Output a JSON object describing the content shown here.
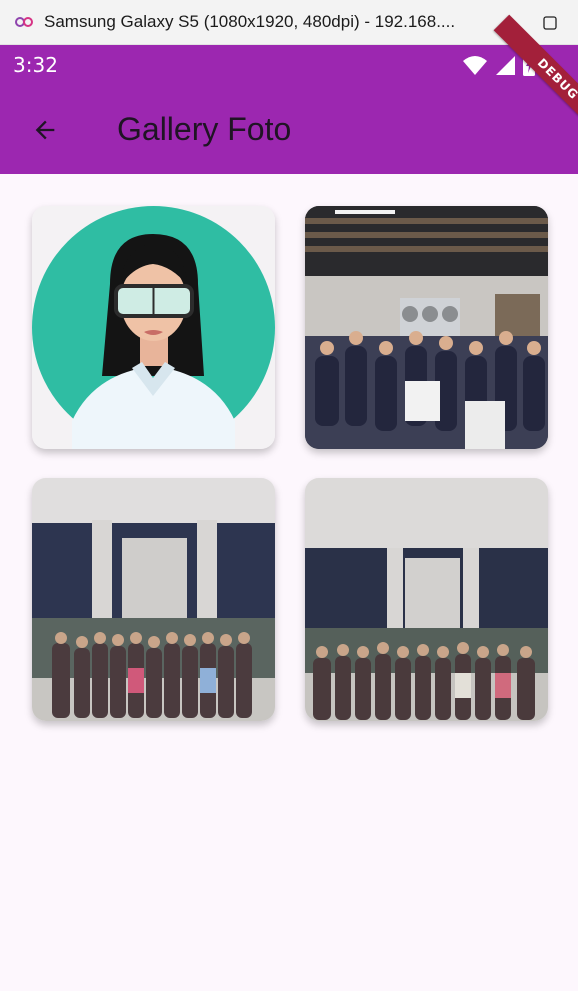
{
  "window": {
    "title": "Samsung Galaxy S5 (1080x1920, 480dpi) - 192.168....",
    "minimize_icon": "minimize-icon",
    "maximize_icon": "maximize-icon"
  },
  "status_bar": {
    "time": "3:32",
    "icons": [
      "wifi-icon",
      "signal-icon",
      "battery-icon"
    ]
  },
  "app_bar": {
    "title": "Gallery Foto",
    "back_icon": "arrow-back-icon",
    "color": "#9c27b0"
  },
  "debug_banner": {
    "label": "DEBUG"
  },
  "gallery": {
    "items": [
      {
        "name": "avatar-illustration"
      },
      {
        "name": "group-photo-restaurant"
      },
      {
        "name": "group-photo-building-1"
      },
      {
        "name": "group-photo-building-2"
      }
    ]
  }
}
